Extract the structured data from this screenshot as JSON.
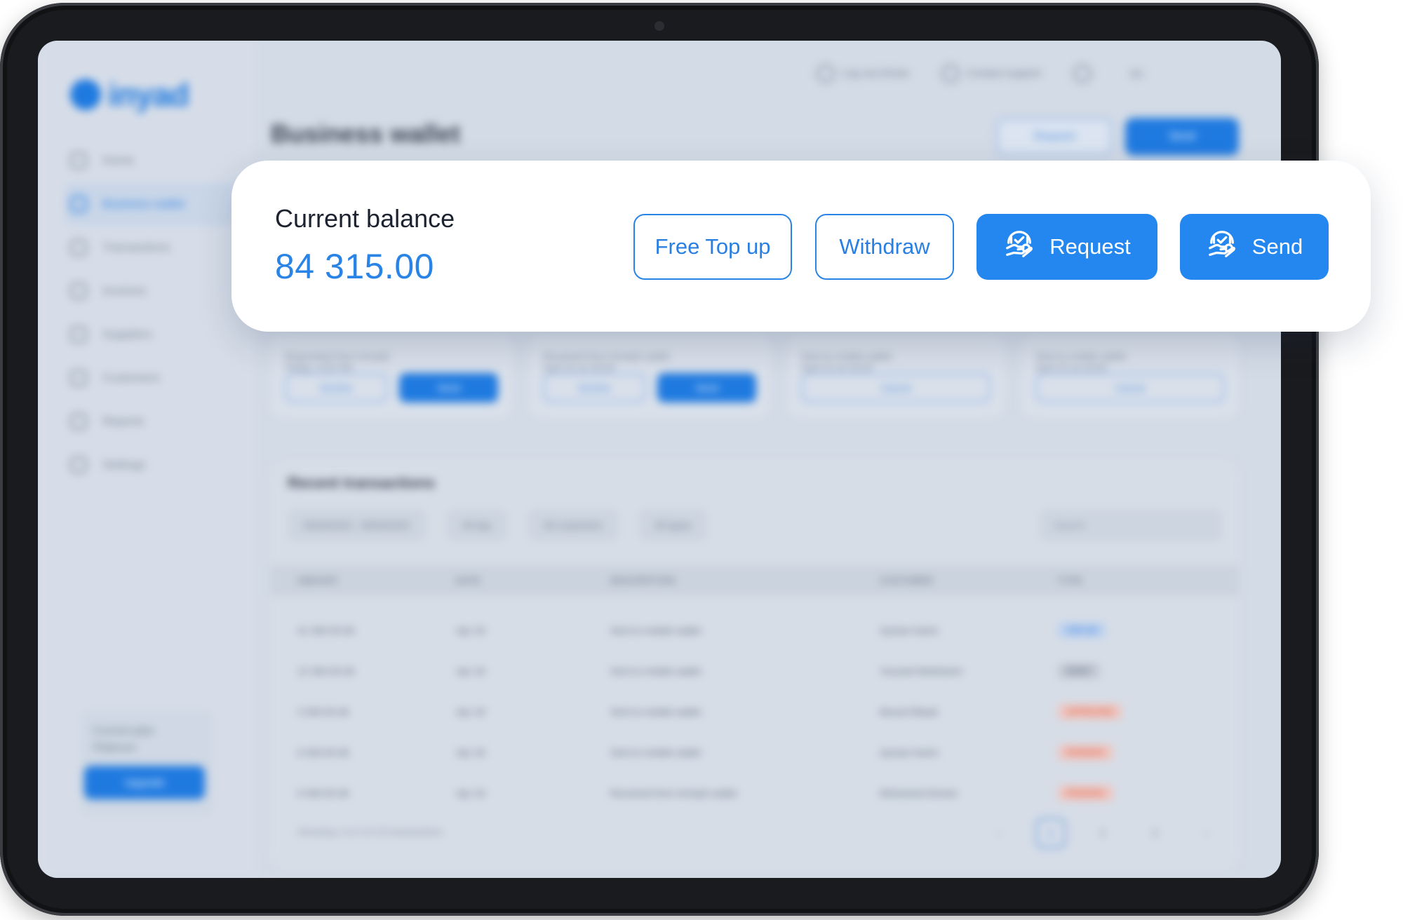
{
  "app": {
    "brand": "inyad",
    "page_title": "Business wallet",
    "topbar": {
      "logout": "Log out Amine",
      "support": "Contact support",
      "language": "En"
    },
    "header_buttons": {
      "request": "Request",
      "send": "Send"
    },
    "sidebar": {
      "items": [
        {
          "label": "Home"
        },
        {
          "label": "Business wallet"
        },
        {
          "label": "Transactions"
        },
        {
          "label": "Invoices"
        },
        {
          "label": "Suppliers"
        },
        {
          "label": "Customers"
        },
        {
          "label": "Reports"
        },
        {
          "label": "Settings"
        }
      ],
      "plan_label": "Current plan",
      "plan_value": "Platinum",
      "upgrade": "Upgrade"
    },
    "requests": [
      {
        "title": "Requested from Inmaah",
        "time": "Today, 4:05 PM",
        "left": "Decline",
        "right": "Send"
      },
      {
        "title": "Received from Inmaah wallet",
        "time": "April 22 at 18:00",
        "left": "Decline",
        "right": "Send"
      },
      {
        "title": "Sent to mobile wallet",
        "time": "April 22 at 18:00",
        "single": "Cancel"
      },
      {
        "title": "Sent to mobile wallet",
        "time": "April 22 at 18:00",
        "single": "Cancel"
      }
    ],
    "transactions": {
      "title": "Recent transactions",
      "filters": [
        "04/03/2022 - 09/03/2022",
        "All day",
        "All customers",
        "All types"
      ],
      "search_placeholder": "Search",
      "columns": [
        "AMOUNT",
        "DATE",
        "DESCRIPTION",
        "CUSTOMER",
        "TYPE"
      ],
      "rows": [
        {
          "amount": "41 300.00 dh",
          "date": "Apr 18",
          "description": "Sent to mobile wallet",
          "customer": "Ayman Karim",
          "type": "TOP UP",
          "type_color": "blue"
        },
        {
          "amount": "12 300.00 dh",
          "date": "Apr 18",
          "description": "Sent to mobile wallet",
          "customer": "Youssef Mokhtarim",
          "type": "DEBIT",
          "type_color": "gray"
        },
        {
          "amount": "3 300.00 dh",
          "date": "Apr 18",
          "description": "Sent to mobile wallet",
          "customer": "Mourd Elbadi",
          "type": "APPROVED",
          "type_color": "red"
        },
        {
          "amount": "6 400.00 dh",
          "date": "Apr 18",
          "description": "Sent to mobile wallet",
          "customer": "Ayman Karim",
          "type": "PENDING",
          "type_color": "red"
        },
        {
          "amount": "9 300.00 dh",
          "date": "Apr 18",
          "description": "Received from Inmaah wallet",
          "customer": "Mohamed Ahmed",
          "type": "PENDING",
          "type_color": "red"
        }
      ],
      "footer": "Showing 1 to 5 of 15 transactions",
      "pages": [
        "1",
        "2",
        "3"
      ],
      "current_page": "1"
    }
  },
  "balance_card": {
    "label": "Current balance",
    "amount": "84 315.00",
    "buttons": {
      "free_top_up": "Free Top up",
      "withdraw": "Withdraw",
      "request": "Request",
      "send": "Send"
    },
    "icons": {
      "request": "hand-coin-icon",
      "send": "hand-coin-icon"
    }
  },
  "colors": {
    "accent": "#2487f0",
    "accent_text": "#2a84e6",
    "device_frame": "#1a1b1e",
    "screen_bg": "#d3dbe6"
  }
}
